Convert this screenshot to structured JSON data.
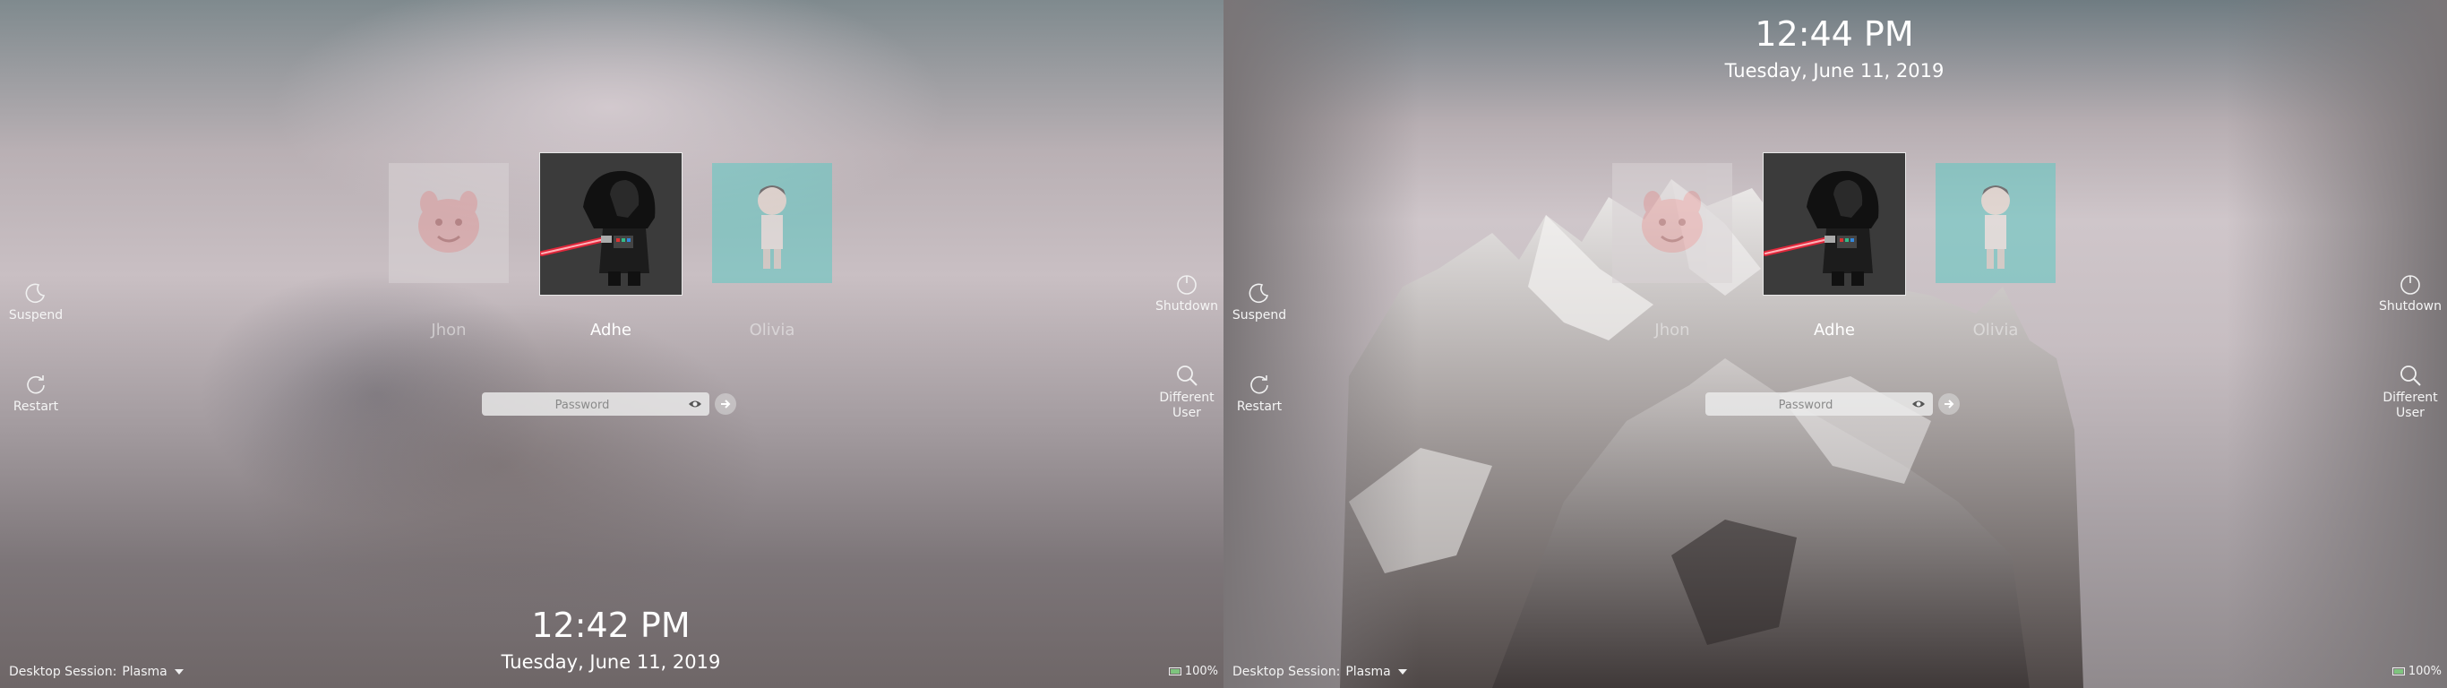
{
  "screens": [
    {
      "clock": {
        "time": "12:42 PM",
        "date": "Tuesday, June 11, 2019"
      },
      "users": [
        {
          "name": "Jhon",
          "selected": false
        },
        {
          "name": "Adhe",
          "selected": true
        },
        {
          "name": "Olivia",
          "selected": false
        }
      ],
      "password": {
        "placeholder": "Password"
      },
      "actions_left": [
        {
          "label": "Suspend",
          "icon": "suspend-icon"
        },
        {
          "label": "Restart",
          "icon": "restart-icon"
        }
      ],
      "actions_right": [
        {
          "label": "Shutdown",
          "icon": "shutdown-icon"
        },
        {
          "label": "Different User",
          "icon": "search-icon"
        }
      ],
      "session": {
        "label": "Desktop Session:",
        "value": "Plasma"
      },
      "battery": {
        "percent": "100%"
      }
    },
    {
      "clock": {
        "time": "12:44 PM",
        "date": "Tuesday, June 11, 2019"
      },
      "users": [
        {
          "name": "Jhon",
          "selected": false
        },
        {
          "name": "Adhe",
          "selected": true
        },
        {
          "name": "Olivia",
          "selected": false
        }
      ],
      "password": {
        "placeholder": "Password"
      },
      "actions_left": [
        {
          "label": "Suspend",
          "icon": "suspend-icon"
        },
        {
          "label": "Restart",
          "icon": "restart-icon"
        }
      ],
      "actions_right": [
        {
          "label": "Shutdown",
          "icon": "shutdown-icon"
        },
        {
          "label": "Different User",
          "icon": "search-icon"
        }
      ],
      "session": {
        "label": "Desktop Session:",
        "value": "Plasma"
      },
      "battery": {
        "percent": "100%"
      }
    }
  ],
  "colors": {
    "accent_teal": "#5ec9c3",
    "saber_red": "#e0263a"
  }
}
